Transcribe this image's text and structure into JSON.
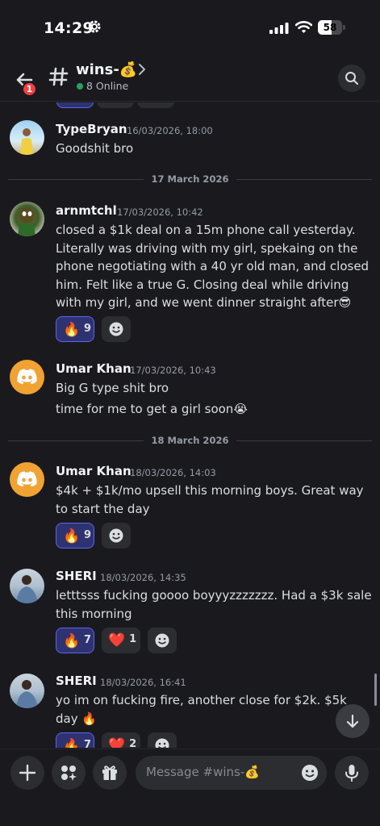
{
  "status_bar": {
    "time": "14:29",
    "battery": "58",
    "battery_level": 0.58
  },
  "header": {
    "channel_name": "wins-💰",
    "online": "8 Online",
    "back_badge": "1"
  },
  "dividers": [
    {
      "label": "17 March 2026"
    },
    {
      "label": "18 March 2026"
    }
  ],
  "messages": [
    {
      "author": "TypeBryan",
      "timestamp": "16/03/2026, 18:00",
      "avatar": "user-photo-avatar",
      "lines": [
        "Goodshit bro"
      ],
      "reactions": []
    },
    {
      "author": "arnmtchl",
      "timestamp": "17/03/2026, 10:42",
      "avatar": "user-photo-avatar",
      "lines": [
        "closed a $1k deal on a 15m phone call yesterday. Literally was driving with my girl, spekaing on the phone negotiating with a 40 yr old man, and closed him. Felt like a true G. Closing deal while driving with my girl, and we went dinner straight after😎"
      ],
      "reactions": [
        {
          "emoji": "🔥",
          "count": "9",
          "active": true
        }
      ]
    },
    {
      "author": "Umar Khan",
      "timestamp": "17/03/2026, 10:43",
      "avatar": "discord-default-avatar",
      "lines": [
        "Big G type shit bro",
        "time for me to get a girl soon😭"
      ],
      "reactions": []
    },
    {
      "author": "Umar Khan",
      "timestamp": "18/03/2026, 14:03",
      "avatar": "discord-default-avatar",
      "lines": [
        "$4k + $1k/mo upsell this morning boys. Great way to start the day"
      ],
      "reactions": [
        {
          "emoji": "🔥",
          "count": "9",
          "active": true
        }
      ]
    },
    {
      "author": "SHERI",
      "timestamp": "18/03/2026, 14:35",
      "avatar": "user-photo-avatar",
      "lines": [
        "letttsss fucking goooo boyyyzzzzzzz. Had a $3k sale this morning"
      ],
      "reactions": [
        {
          "emoji": "🔥",
          "count": "7",
          "active": true
        },
        {
          "emoji": "❤️",
          "count": "1",
          "active": false
        }
      ]
    },
    {
      "author": "SHERI",
      "timestamp": "18/03/2026, 16:41",
      "avatar": "user-photo-avatar",
      "lines": [
        "yo im on fucking fire, another close for $2k. $5k day 🔥"
      ],
      "reactions": [
        {
          "emoji": "🔥",
          "count": "7",
          "active": true
        },
        {
          "emoji": "❤️",
          "count": "2",
          "active": false
        }
      ]
    }
  ],
  "composer": {
    "placeholder": "Message #wins-💰"
  },
  "icons": {
    "back": "arrow-left-icon",
    "search": "search-icon",
    "add": "plus-icon",
    "apps": "apps-icon",
    "gift": "gift-icon",
    "emoji": "emoji-icon",
    "mic": "microphone-icon",
    "jump": "arrow-down-icon",
    "add_reaction": "add-reaction-icon"
  },
  "colors": {
    "background": "#1a1a1e",
    "accent": "#5865f2",
    "online": "#23a55a",
    "badge": "#f23f43",
    "discord_avatar": "#f0a232"
  }
}
